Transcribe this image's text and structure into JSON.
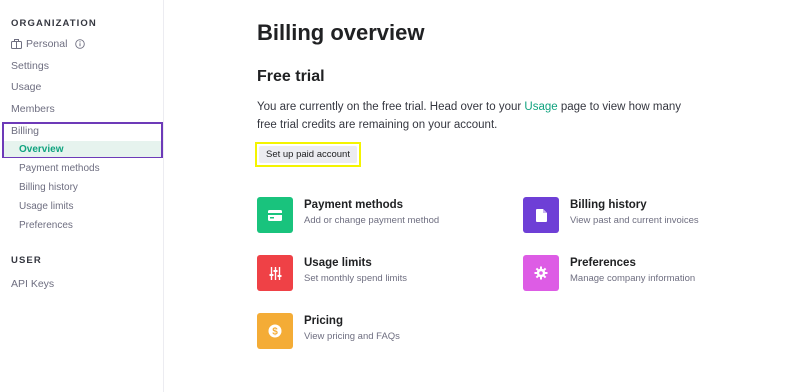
{
  "sidebar": {
    "organization_heading": "ORGANIZATION",
    "personal_label": "Personal",
    "settings": "Settings",
    "usage": "Usage",
    "members": "Members",
    "billing": "Billing",
    "billing_items": [
      "Overview",
      "Payment methods",
      "Billing history",
      "Usage limits",
      "Preferences"
    ],
    "user_heading": "USER",
    "api_keys": "API Keys"
  },
  "main": {
    "title": "Billing overview",
    "section_title": "Free trial",
    "trial_text_before": "You are currently on the free trial. Head over to your ",
    "trial_link": "Usage",
    "trial_text_after": " page to view how many free trial credits are remaining on your account.",
    "cta_label": "Set up paid account",
    "cards": [
      {
        "title": "Payment methods",
        "desc": "Add or change payment method",
        "icon": "credit-card-icon",
        "color": "#19c37d"
      },
      {
        "title": "Billing history",
        "desc": "View past and current invoices",
        "icon": "document-icon",
        "color": "#6e3fd6"
      },
      {
        "title": "Usage limits",
        "desc": "Set monthly spend limits",
        "icon": "sliders-icon",
        "color": "#ef4146"
      },
      {
        "title": "Preferences",
        "desc": "Manage company information",
        "icon": "gear-icon",
        "color": "#dd5ce5"
      },
      {
        "title": "Pricing",
        "desc": "View pricing and FAQs",
        "icon": "dollar-icon",
        "color": "#f4ac36"
      }
    ]
  },
  "colors": {
    "accent": "#10a37f",
    "highlight_outline": "#f4f400",
    "billing_outline": "#6d3ab8"
  }
}
